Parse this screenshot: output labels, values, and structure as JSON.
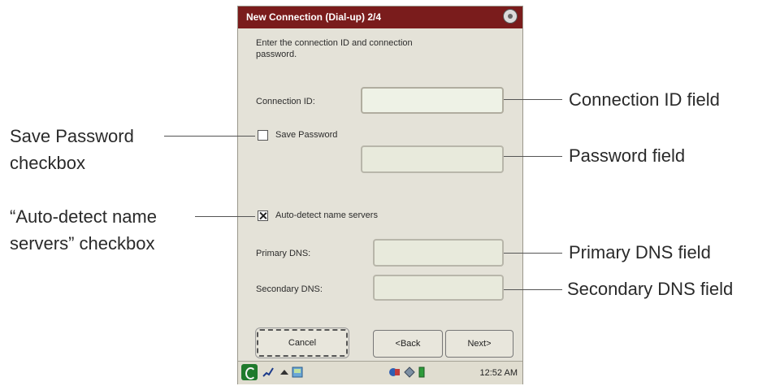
{
  "window": {
    "title": "New Connection (Dial-up) 2/4",
    "instruction": "Enter the connection ID and connection password."
  },
  "form": {
    "connection_id_label": "Connection ID:",
    "connection_id_value": "",
    "save_password_label": "Save Password",
    "save_password_checked": false,
    "password_value": "",
    "auto_detect_label": "Auto-detect name servers",
    "auto_detect_checked": true,
    "primary_dns_label": "Primary DNS:",
    "primary_dns_value": "",
    "secondary_dns_label": "Secondary DNS:",
    "secondary_dns_value": ""
  },
  "buttons": {
    "cancel": "Cancel",
    "back": "<Back",
    "next": "Next>"
  },
  "taskbar": {
    "time": "12:52 AM"
  },
  "callouts": {
    "connection_id_field": "Connection ID field",
    "password_field": "Password field",
    "primary_dns_field": "Primary DNS field",
    "secondary_dns_field": "Secondary DNS field",
    "save_password_line1": "Save Password",
    "save_password_line2": "checkbox",
    "auto_detect_line1": "“Auto-detect name",
    "auto_detect_line2": "servers” checkbox"
  },
  "colors": {
    "titlebar": "#7a1c1c",
    "dialog_bg": "#e4e2d8",
    "start_icon": "#1f7a2c"
  }
}
